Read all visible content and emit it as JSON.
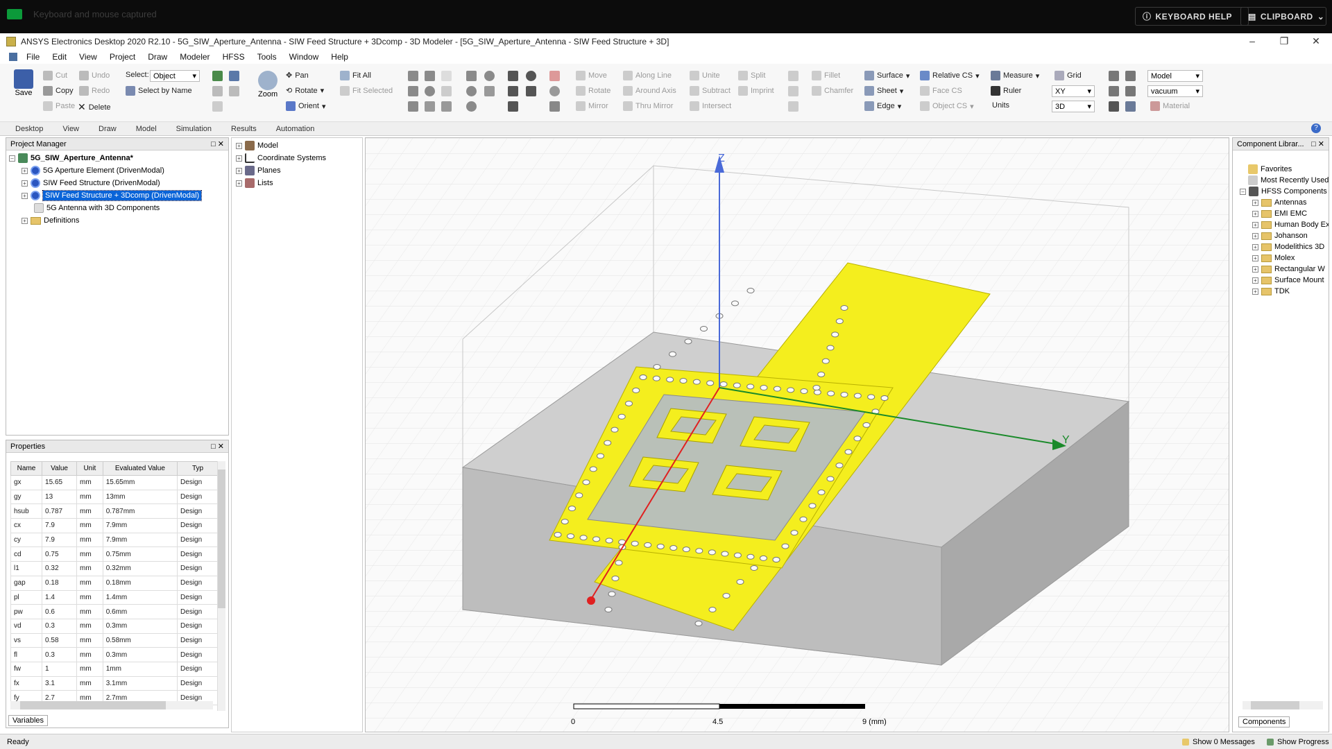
{
  "topbar": {
    "capture_text": "Keyboard and mouse captured",
    "keyboard_help": "KEYBOARD HELP",
    "clipboard": "CLIPBOARD"
  },
  "window": {
    "title": "ANSYS Electronics Desktop 2020 R2.10 - 5G_SIW_Aperture_Antenna - SIW Feed Structure + 3Dcomp - 3D Modeler - [5G_SIW_Aperture_Antenna - SIW Feed Structure + 3D]"
  },
  "menu": [
    "File",
    "Edit",
    "View",
    "Project",
    "Draw",
    "Modeler",
    "HFSS",
    "Tools",
    "Window",
    "Help"
  ],
  "ribbon": {
    "save": "Save",
    "cut": "Cut",
    "undo": "Undo",
    "copy": "Copy",
    "redo": "Redo",
    "paste": "Paste",
    "delete": "Delete",
    "select_label": "Select:",
    "select_value": "Object",
    "select_by_name": "Select by Name",
    "zoom": "Zoom",
    "pan": "Pan",
    "rotate": "Rotate",
    "orient": "Orient",
    "fit_all": "Fit All",
    "fit_selected": "Fit Selected",
    "move": "Move",
    "rotate2": "Rotate",
    "mirror": "Mirror",
    "along_line": "Along Line",
    "around_axis": "Around Axis",
    "thru_mirror": "Thru Mirror",
    "unite": "Unite",
    "subtract": "Subtract",
    "intersect": "Intersect",
    "split": "Split",
    "imprint": "Imprint",
    "fillet": "Fillet",
    "chamfer": "Chamfer",
    "surface": "Surface",
    "sheet": "Sheet",
    "edge": "Edge",
    "relative_cs": "Relative CS",
    "face_cs": "Face CS",
    "object_cs": "Object CS",
    "measure": "Measure",
    "ruler": "Ruler",
    "units": "Units",
    "grid": "Grid",
    "plane": "XY",
    "mode3d": "3D",
    "model": "Model",
    "material": "vacuum",
    "material_btn": "Material"
  },
  "tabs": [
    "Desktop",
    "View",
    "Draw",
    "Model",
    "Simulation",
    "Results",
    "Automation"
  ],
  "project_manager": {
    "title": "Project Manager",
    "project": "5G_SIW_Aperture_Antenna*",
    "designs": [
      "5G Aperture Element (DrivenModal)",
      "SIW Feed Structure (DrivenModal)",
      "SIW Feed Structure + 3Dcomp (DrivenModal)",
      "5G Antenna with 3D Components"
    ],
    "definitions": "Definitions"
  },
  "model_tree": [
    "Model",
    "Coordinate Systems",
    "Planes",
    "Lists"
  ],
  "properties": {
    "title": "Properties",
    "headers": [
      "Name",
      "Value",
      "Unit",
      "Evaluated Value",
      "Typ"
    ],
    "rows": [
      [
        "gx",
        "15.65",
        "mm",
        "15.65mm",
        "Design"
      ],
      [
        "gy",
        "13",
        "mm",
        "13mm",
        "Design"
      ],
      [
        "hsub",
        "0.787",
        "mm",
        "0.787mm",
        "Design"
      ],
      [
        "cx",
        "7.9",
        "mm",
        "7.9mm",
        "Design"
      ],
      [
        "cy",
        "7.9",
        "mm",
        "7.9mm",
        "Design"
      ],
      [
        "cd",
        "0.75",
        "mm",
        "0.75mm",
        "Design"
      ],
      [
        "l1",
        "0.32",
        "mm",
        "0.32mm",
        "Design"
      ],
      [
        "gap",
        "0.18",
        "mm",
        "0.18mm",
        "Design"
      ],
      [
        "pl",
        "1.4",
        "mm",
        "1.4mm",
        "Design"
      ],
      [
        "pw",
        "0.6",
        "mm",
        "0.6mm",
        "Design"
      ],
      [
        "vd",
        "0.3",
        "mm",
        "0.3mm",
        "Design"
      ],
      [
        "vs",
        "0.58",
        "mm",
        "0.58mm",
        "Design"
      ],
      [
        "fl",
        "0.3",
        "mm",
        "0.3mm",
        "Design"
      ],
      [
        "fw",
        "1",
        "mm",
        "1mm",
        "Design"
      ],
      [
        "fx",
        "3.1",
        "mm",
        "3.1mm",
        "Design"
      ],
      [
        "fy",
        "2.7",
        "mm",
        "2.7mm",
        "Design"
      ]
    ],
    "tab": "Variables"
  },
  "viewport": {
    "axis_z": "Z",
    "axis_y": "Y",
    "scale_labels": [
      "0",
      "4.5",
      "9 (mm)"
    ]
  },
  "component_library": {
    "title": "Component Librar...",
    "favorites": "Favorites",
    "recent": "Most Recently Used",
    "hfss": "HFSS Components",
    "folders": [
      "Antennas",
      "EMI EMC",
      "Human Body Ex",
      "Johanson",
      "Modelithics 3D",
      "Molex",
      "Rectangular W",
      "Surface Mount",
      "TDK"
    ],
    "tab": "Components"
  },
  "status": {
    "ready": "Ready",
    "messages": "Show 0 Messages",
    "progress": "Show Progress"
  }
}
